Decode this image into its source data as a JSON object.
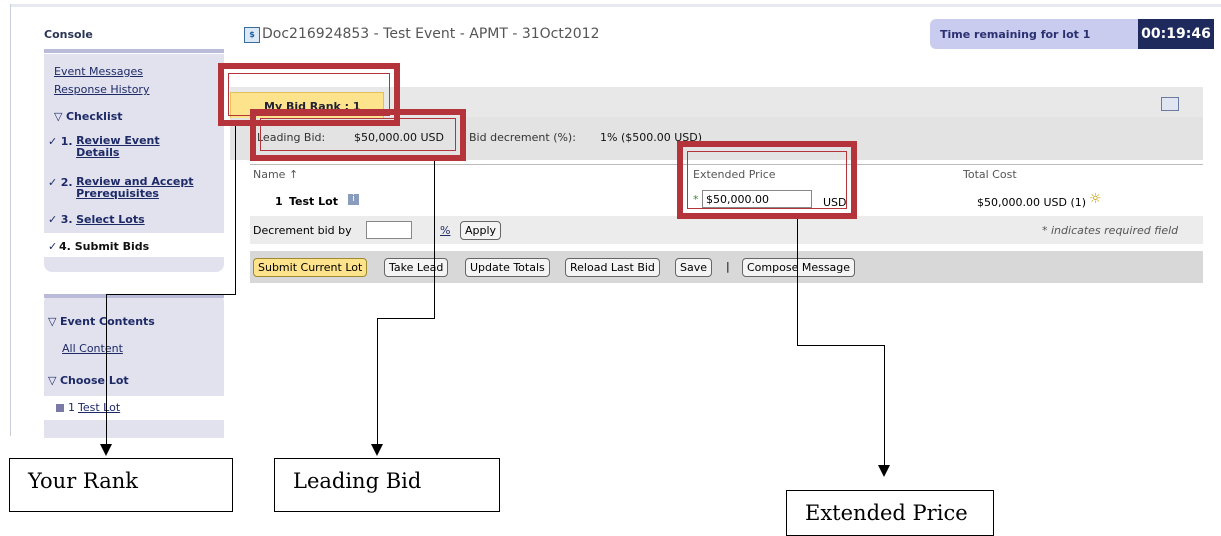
{
  "sidebar": {
    "title": "Console",
    "links": [
      "Event Messages",
      "Response History"
    ],
    "checklist_heading": "Checklist",
    "checklist": [
      {
        "num": "1.",
        "label": "Review Event Details"
      },
      {
        "num": "2.",
        "label": "Review and Accept Prerequisites"
      },
      {
        "num": "3.",
        "label": "Select Lots"
      },
      {
        "num": "4.",
        "label": "Submit Bids"
      }
    ],
    "event_contents_heading": "Event Contents",
    "all_content": "All Content",
    "choose_lot_heading": "Choose Lot",
    "lot_num": "1",
    "lot_label": "Test Lot"
  },
  "header": {
    "doc_title": "Doc216924853 - Test Event - APMT - 31Oct2012",
    "timer_label": "Time remaining for lot 1",
    "timer_value": "00:19:46"
  },
  "main": {
    "tab_label": "My Bid Rank : 1",
    "leading_bid_label": "Leading Bid:",
    "leading_bid_value": "$50,000.00 USD",
    "bid_decrement_label": "Bid decrement (%):",
    "bid_decrement_value": "1% ($500.00 USD)",
    "columns": {
      "name": "Name ↑",
      "extended_price": "Extended Price",
      "total_cost": "Total Cost"
    },
    "row": {
      "num": "1",
      "name": "Test Lot",
      "extended_price": "$50,000.00",
      "currency": "USD",
      "total_cost": "$50,000.00 USD (1)"
    },
    "decrement_label": "Decrement bid by",
    "percent_label": "%",
    "apply_label": "Apply",
    "required_note": "* indicates required field",
    "buttons": [
      "Submit Current Lot",
      "Take Lead",
      "Update Totals",
      "Reload Last Bid",
      "Save",
      "Compose Message"
    ],
    "separator": "|"
  },
  "annotations": {
    "rank": "Your Rank",
    "leading_bid": "Leading Bid",
    "extended_price": "Extended Price"
  },
  "colors": {
    "annotation_frame": "#b5333a",
    "tab": "#fde38c",
    "timer_bg": "#1f2a5c",
    "sidebar": "#e2e2ef"
  }
}
